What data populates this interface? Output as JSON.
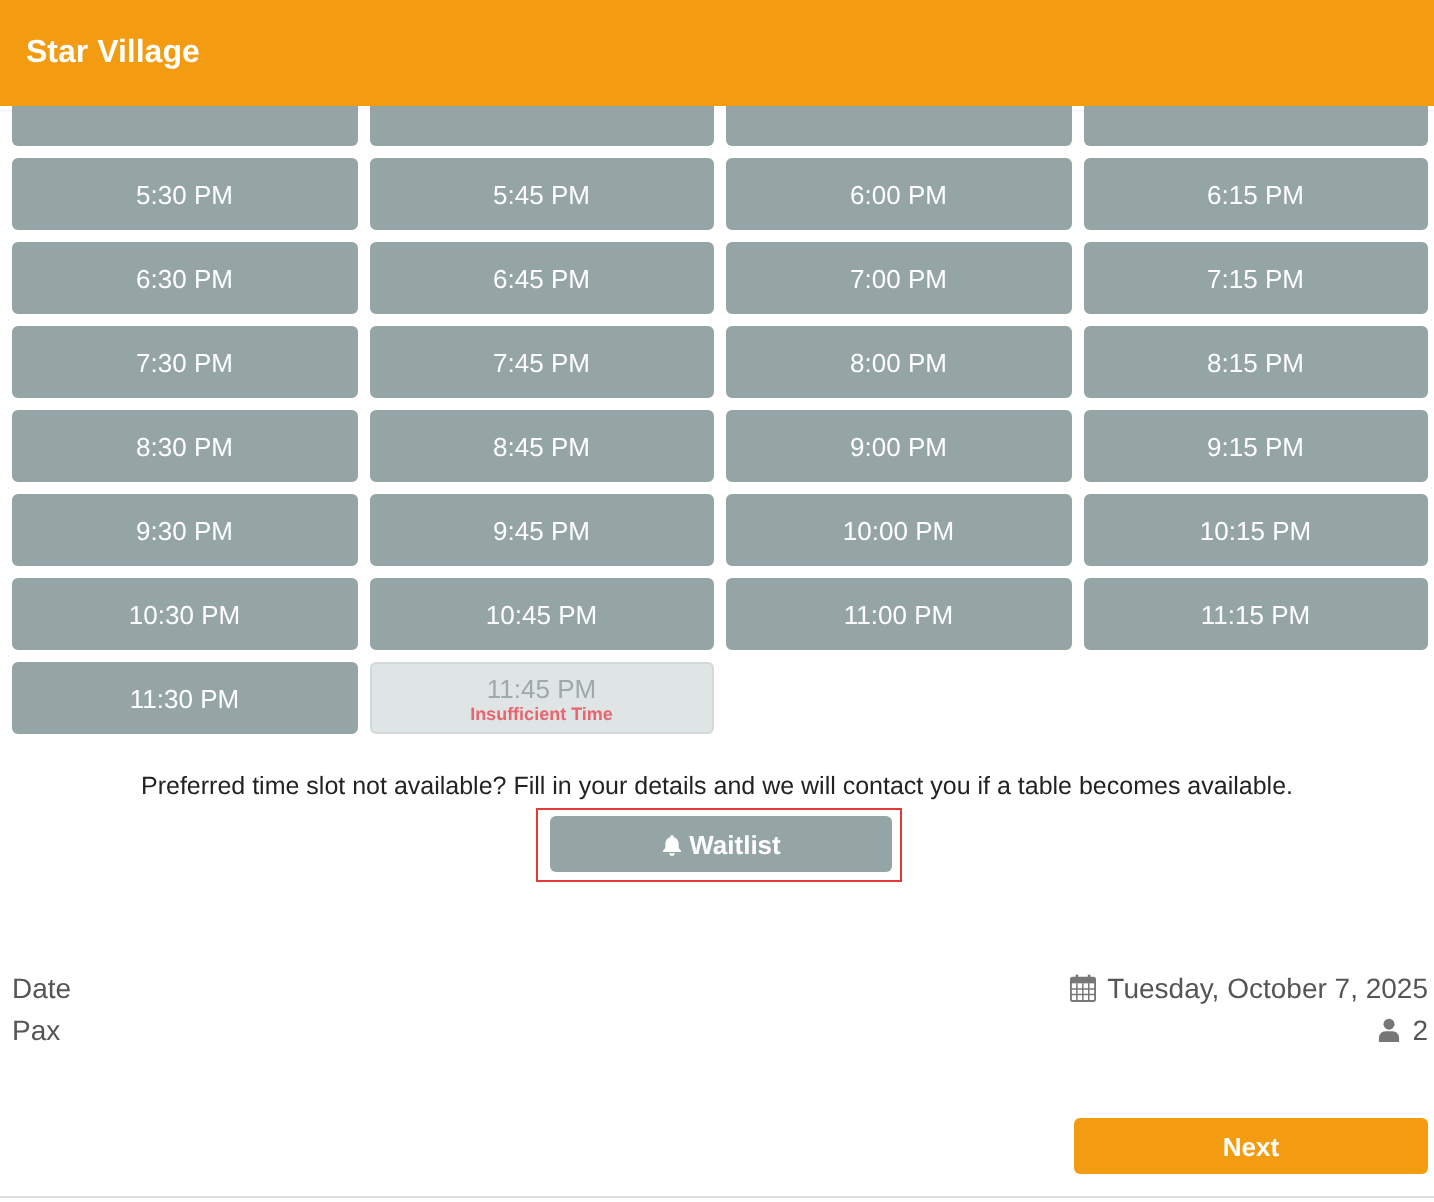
{
  "header": {
    "title": "Star Village"
  },
  "time_slots": [
    {
      "disabled": false
    },
    {
      "disabled": false
    },
    {
      "disabled": false
    },
    {
      "disabled": false
    },
    {
      "time": "5:30 PM",
      "disabled": false
    },
    {
      "time": "5:45 PM",
      "disabled": false
    },
    {
      "time": "6:00 PM",
      "disabled": false
    },
    {
      "time": "6:15 PM",
      "disabled": false
    },
    {
      "time": "6:30 PM",
      "disabled": false
    },
    {
      "time": "6:45 PM",
      "disabled": false
    },
    {
      "time": "7:00 PM",
      "disabled": false
    },
    {
      "time": "7:15 PM",
      "disabled": false
    },
    {
      "time": "7:30 PM",
      "disabled": false
    },
    {
      "time": "7:45 PM",
      "disabled": false
    },
    {
      "time": "8:00 PM",
      "disabled": false
    },
    {
      "time": "8:15 PM",
      "disabled": false
    },
    {
      "time": "8:30 PM",
      "disabled": false
    },
    {
      "time": "8:45 PM",
      "disabled": false
    },
    {
      "time": "9:00 PM",
      "disabled": false
    },
    {
      "time": "9:15 PM",
      "disabled": false
    },
    {
      "time": "9:30 PM",
      "disabled": false
    },
    {
      "time": "9:45 PM",
      "disabled": false
    },
    {
      "time": "10:00 PM",
      "disabled": false
    },
    {
      "time": "10:15 PM",
      "disabled": false
    },
    {
      "time": "10:30 PM",
      "disabled": false
    },
    {
      "time": "10:45 PM",
      "disabled": false
    },
    {
      "time": "11:00 PM",
      "disabled": false
    },
    {
      "time": "11:15 PM",
      "disabled": false
    },
    {
      "time": "11:30 PM",
      "disabled": false
    },
    {
      "time": "11:45 PM",
      "disabled": true,
      "note": "Insufficient Time"
    }
  ],
  "waitlist": {
    "message": "Preferred time slot not available? Fill in your details and we will contact you if a table becomes available.",
    "button": "Waitlist",
    "highlighted": true
  },
  "summary": [
    {
      "kind": "date",
      "label": "Date",
      "value": "Tuesday, October 7, 2025"
    },
    {
      "kind": "pax",
      "label": "Pax",
      "value": "2"
    }
  ],
  "next_button": "Next"
}
